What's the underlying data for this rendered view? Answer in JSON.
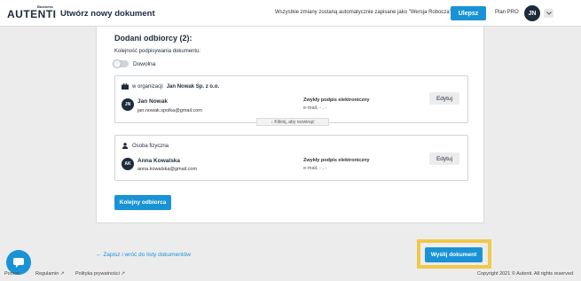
{
  "header": {
    "logo_business": "Business",
    "logo_word": "AUTENTI",
    "title": "Utwórz nowy dokument",
    "autosave": "Wszystkie zmiany zostaną automatycznie zapisane jako \"Wersja Robocza\"",
    "upgrade_label": "Ulepsz",
    "plan_label": "Plan PRO",
    "avatar_initials": "JN"
  },
  "recipients": {
    "title": "Dodani odbiorcy (2):",
    "order_label": "Kolejność podpisywania dokumentu:",
    "order_toggle_on": false,
    "order_value": "Dowolna",
    "items": [
      {
        "org_prefix": "w organizacji",
        "org_name": "Jan Nowak Sp. z o.o.",
        "initials": "JN",
        "name": "Jan Nowak",
        "email": "jan.nowak.spolka@gmail.com",
        "signature_type": "Zwykły podpis elektroniczny",
        "signature_meta": "e-mail,  -  ,  -",
        "edit_label": "Edytuj",
        "expand_label": "↓ Kliknij, aby rozwinąć"
      },
      {
        "type_label": "Osoba fizyczna",
        "initials": "AK",
        "name": "Anna Kowalska",
        "email": "anna.kowalska@gmail.com",
        "signature_type": "Zwykły podpis elektroniczny",
        "signature_meta": "e-mail,  -  ,  -",
        "edit_label": "Edytuj"
      }
    ],
    "next_recipient_label": "Kolejny odbiorca"
  },
  "actions": {
    "back_label": "Zapisz i wróć do listy dokumentów",
    "send_label": "Wyślij dokument"
  },
  "footer": {
    "help": "Pomoc",
    "terms": "Regulamin",
    "privacy": "Polityka prywatności",
    "copyright": "Copyright 2021 © Autenti. All rights reserved"
  },
  "colors": {
    "accent": "#1993d6",
    "highlight": "#f0c84a",
    "dark": "#1d2b3a"
  }
}
